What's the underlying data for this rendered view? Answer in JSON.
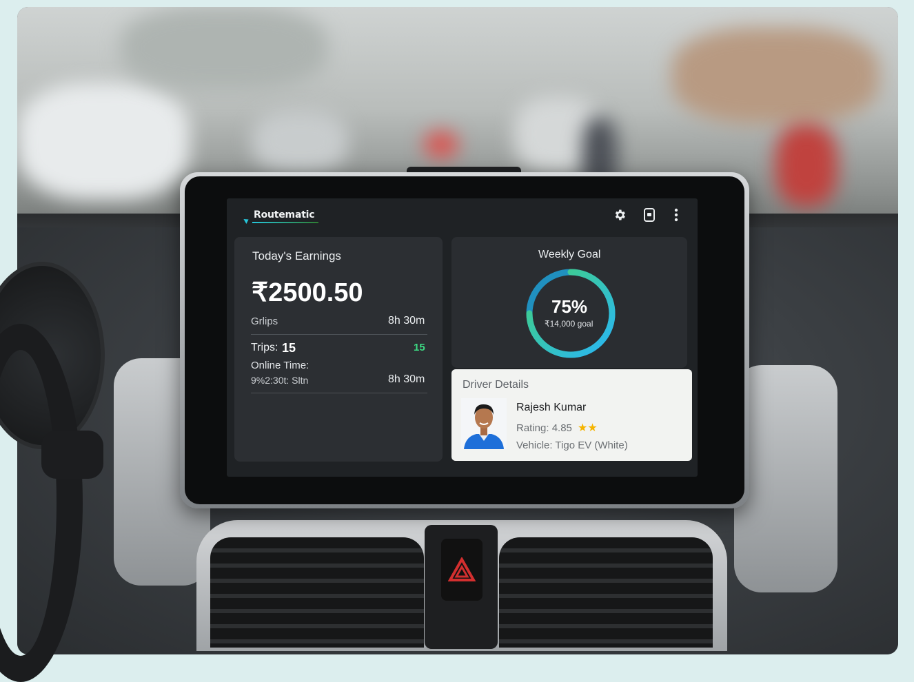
{
  "app": {
    "logo": "Routematic"
  },
  "header": {
    "icons": [
      "gear-icon",
      "device-icon",
      "more-vert-icon"
    ]
  },
  "earnings": {
    "title": "Today's Earnings",
    "amount": "₹2500.50",
    "row1_label": "Grlips",
    "row1_value": "8h 30m",
    "trips_label": "Trips:",
    "trips_value": "15",
    "trips_right": "15",
    "online_label": "Online Time:",
    "online_sub": "9%2:30t: Sltn",
    "online_value": "8h 30m"
  },
  "weekly_goal": {
    "title": "Weekly Goal",
    "percent_text": "75%",
    "progress": 0.75,
    "goal_text": "₹14,000 goal",
    "ring_colors": [
      "#29b6f6",
      "#43d17a"
    ]
  },
  "driver": {
    "section_title": "Driver Details",
    "name": "Rajesh Kumar",
    "rating_text": "Rating: 4.85",
    "stars": "★★",
    "vehicle": "Vehicle: Tigo EV (White)"
  },
  "colors": {
    "accent_green": "#3ddc84",
    "star": "#f5b400"
  }
}
